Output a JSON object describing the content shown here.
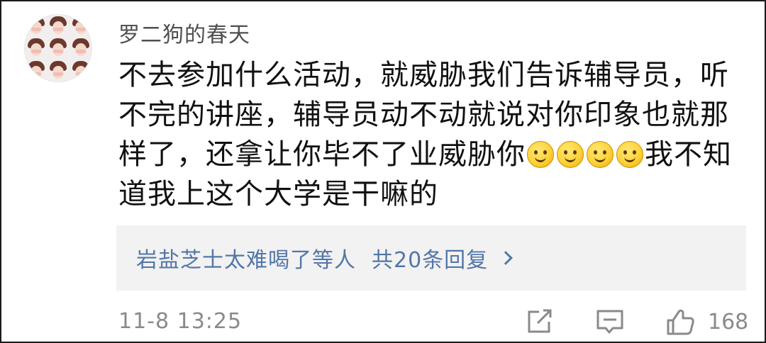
{
  "comment": {
    "username": "罗二狗的春天",
    "lines": [
      "不去参加什么活动，就威胁我们告诉辅导员，听",
      "不完的讲座，辅导员动不动就说对你印象也就那",
      "样了，还拿让你毕不了业威胁你",
      "我不知",
      "道我上这个大学是干嘛的"
    ],
    "emoji_name": "smile-emoji",
    "emoji_count": 4,
    "replies": {
      "from": "岩盐芝士太难喝了等人",
      "count_text": "共20条回复"
    },
    "timestamp": "11-8 13:25",
    "like_count": "168"
  },
  "icons": {
    "share": "share-icon",
    "comment": "comment-icon",
    "like": "thumbs-up-icon"
  },
  "colors": {
    "text": "#111111",
    "username": "#4f4f4f",
    "link": "#5276a8",
    "meta": "#8a8a8a",
    "reply_bg": "#f2f2f2"
  }
}
